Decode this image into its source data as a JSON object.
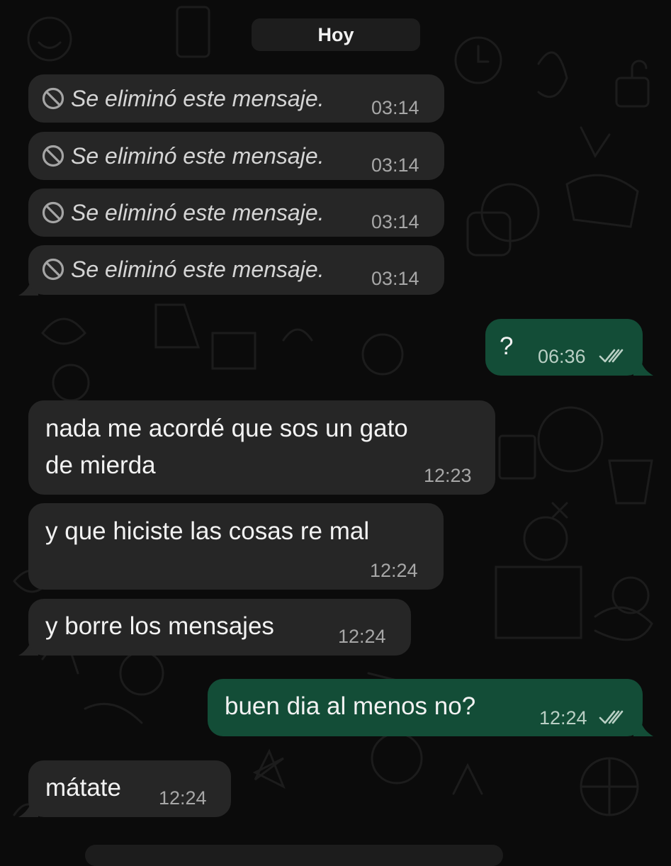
{
  "date_separator": "Hoy",
  "deleted_messages": [
    {
      "text": "Se eliminó este mensaje.",
      "time": "03:14"
    },
    {
      "text": "Se eliminó este mensaje.",
      "time": "03:14"
    },
    {
      "text": "Se eliminó este mensaje.",
      "time": "03:14"
    },
    {
      "text": "Se eliminó este mensaje.",
      "time": "03:14"
    }
  ],
  "messages": [
    {
      "direction": "outgoing",
      "lines": [
        "?"
      ],
      "time": "06:36",
      "status": "read"
    },
    {
      "direction": "incoming",
      "lines": [
        "nada me acordé que sos un gato",
        "de mierda"
      ],
      "time": "12:23"
    },
    {
      "direction": "incoming",
      "lines": [
        "y que hiciste las cosas re mal"
      ],
      "time": "12:24"
    },
    {
      "direction": "incoming",
      "lines": [
        "y borre los mensajes"
      ],
      "time": "12:24"
    },
    {
      "direction": "outgoing",
      "lines": [
        "buen dia al menos no?"
      ],
      "time": "12:24",
      "status": "read"
    },
    {
      "direction": "incoming",
      "lines": [
        "mátate"
      ],
      "time": "12:24"
    }
  ],
  "colors": {
    "background": "#0b0b0b",
    "incoming_bubble": "#262626",
    "outgoing_bubble": "#134d37",
    "date_pill": "#1d1d1d"
  },
  "icons": {
    "deleted": "ban-icon",
    "read_status": "double-check-icon"
  }
}
